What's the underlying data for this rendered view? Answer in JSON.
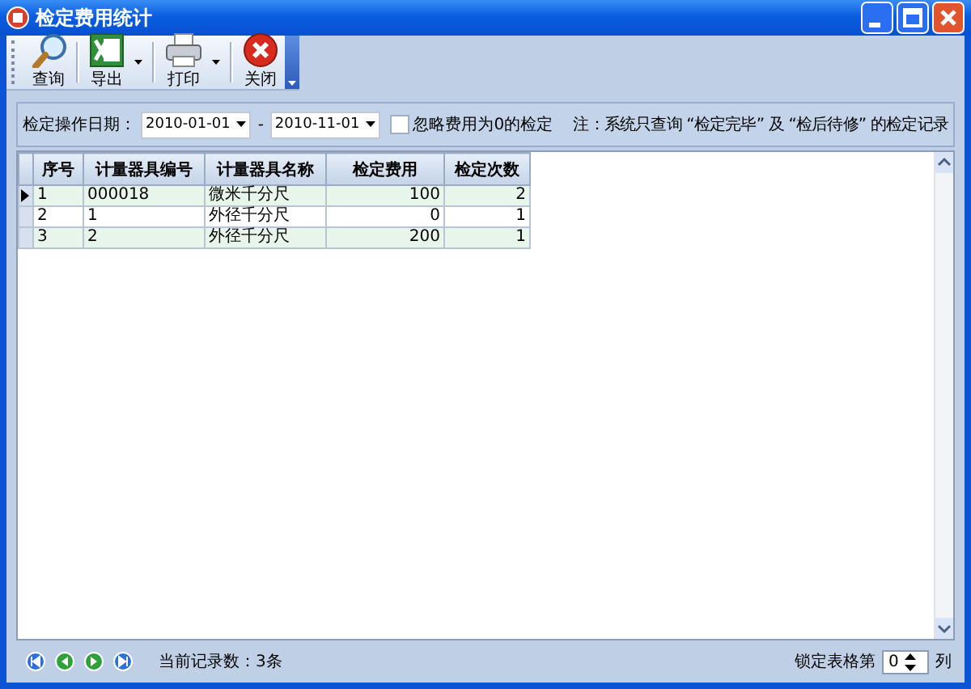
{
  "window": {
    "title": "检定费用统计"
  },
  "toolbar": [
    {
      "label": "查询",
      "kind": "search",
      "dropdown": false
    },
    {
      "label": "导出",
      "kind": "excel",
      "dropdown": true
    },
    {
      "label": "打印",
      "kind": "print",
      "dropdown": true
    },
    {
      "label": "关闭",
      "kind": "close",
      "dropdown": false
    }
  ],
  "filter": {
    "label": "检定操作日期：",
    "date_from": "2010-01-01",
    "separator": "-",
    "date_to": "2010-11-01",
    "ignore_zero": {
      "label": "忽略费用为0的检定",
      "checked": false
    },
    "note": "注：系统只查询 “检定完毕” 及 “检后待修” 的检定记录"
  },
  "grid": {
    "columns": [
      {
        "label": "序号",
        "kind": "text"
      },
      {
        "label": "计量器具编号",
        "kind": "text"
      },
      {
        "label": "计量器具名称",
        "kind": "text"
      },
      {
        "label": "检定费用",
        "kind": "number"
      },
      {
        "label": "检定次数",
        "kind": "number"
      }
    ],
    "rows": [
      {
        "cells": [
          "1",
          "000018",
          "微米千分尺",
          "100",
          "2"
        ],
        "current": true
      },
      {
        "cells": [
          "2",
          "1",
          "外径千分尺",
          "0",
          "1"
        ],
        "current": false
      },
      {
        "cells": [
          "3",
          "2",
          "外径千分尺",
          "200",
          "1"
        ],
        "current": false
      }
    ]
  },
  "footer": {
    "record_count": "当前记录数：3条",
    "freeze_label": "锁定表格第",
    "freeze_value": "0",
    "freeze_unit": "列"
  }
}
